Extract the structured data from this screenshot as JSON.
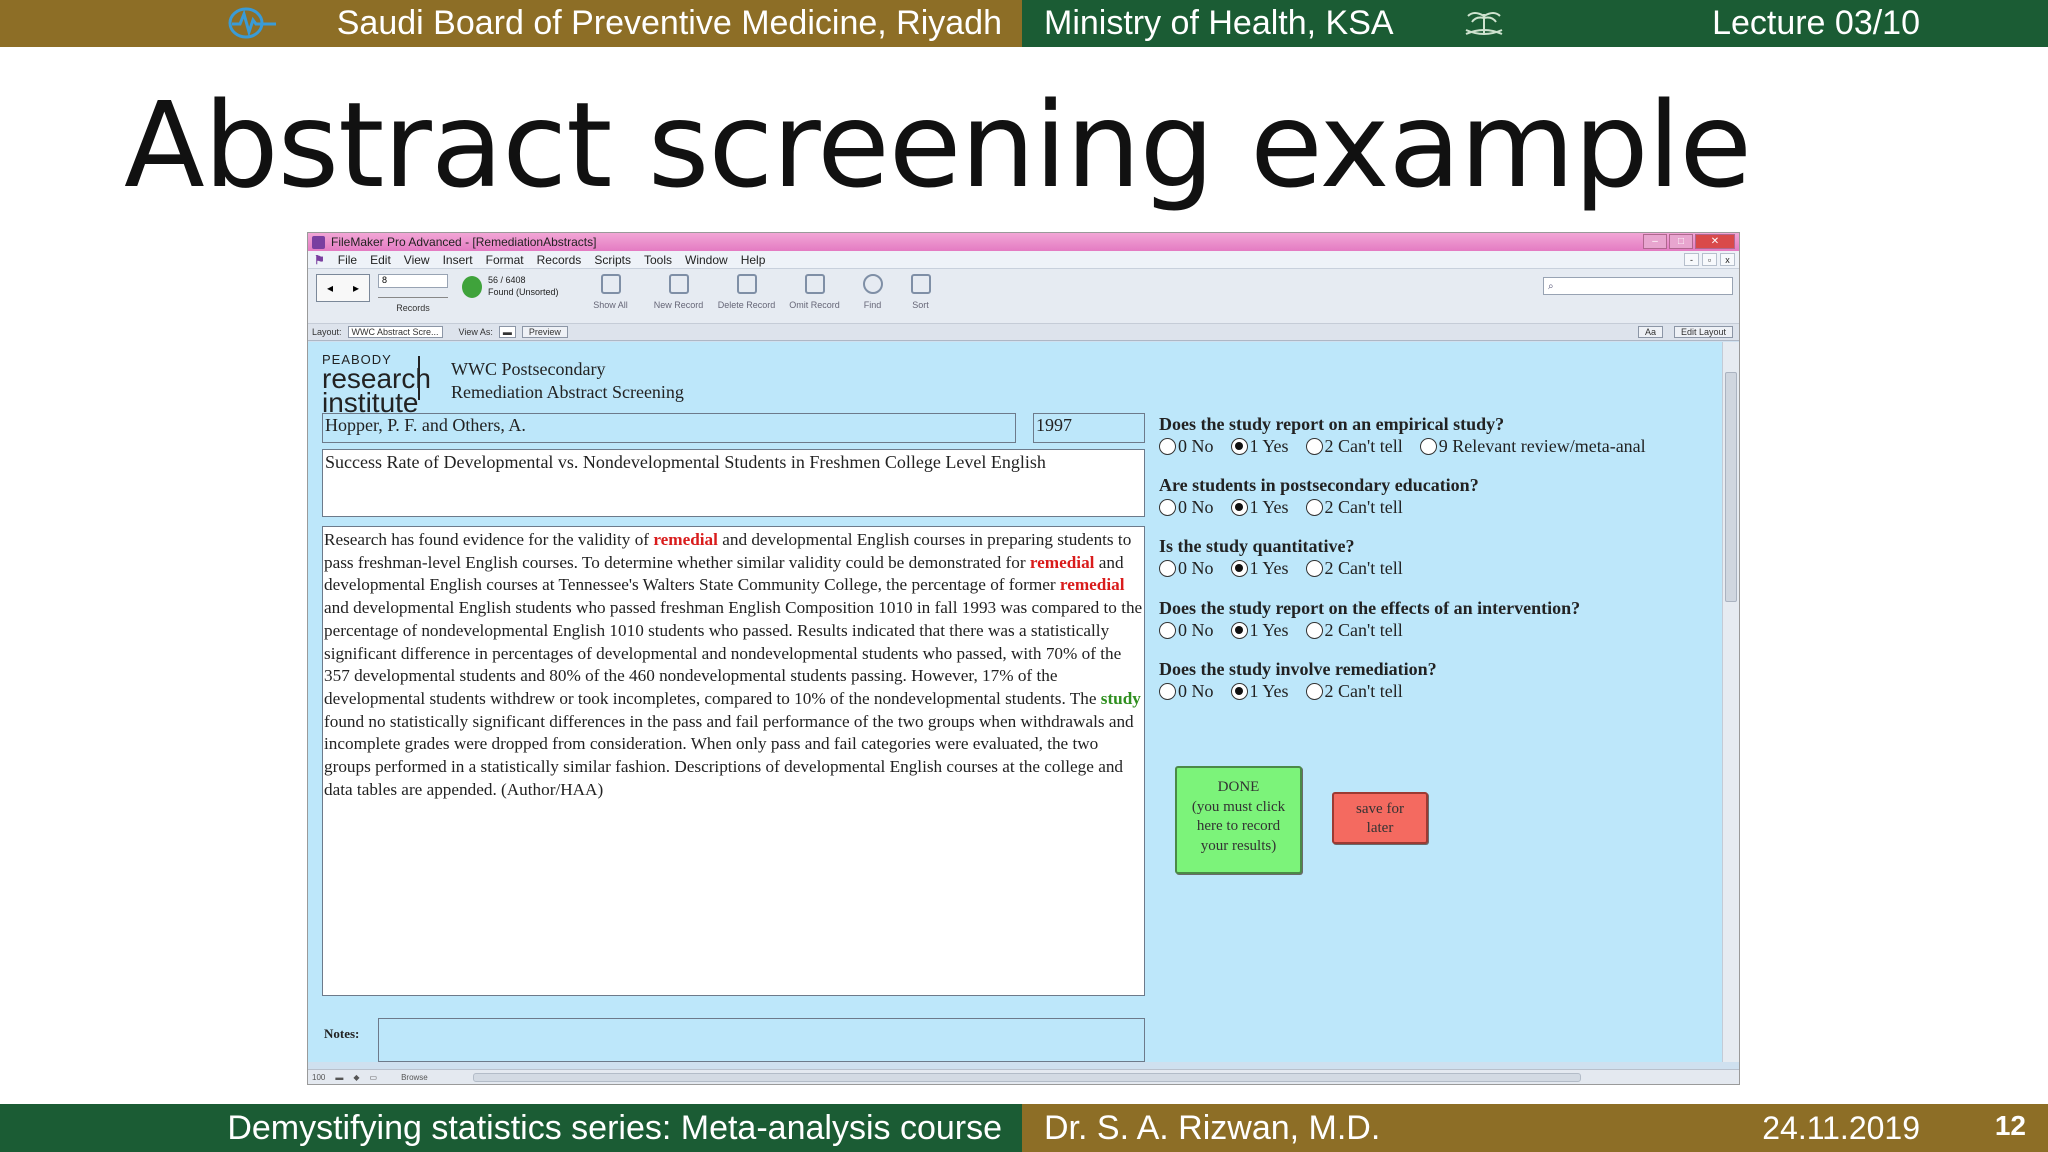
{
  "slide": {
    "header_left": "Saudi Board of Preventive Medicine, Riyadh",
    "header_right": "Ministry of Health, KSA",
    "lecture": "Lecture 03/10",
    "title": "Abstract screening example",
    "footer_left": "Demystifying statistics series: Meta-analysis course",
    "footer_right": "Dr. S. A. Rizwan, M.D.",
    "date": "24.11.2019",
    "slide_number": "12"
  },
  "app": {
    "window_title": "FileMaker Pro Advanced - [RemediationAbstracts]",
    "menu": [
      "File",
      "Edit",
      "View",
      "Insert",
      "Format",
      "Records",
      "Scripts",
      "Tools",
      "Window",
      "Help"
    ],
    "record_input": "8",
    "records_label": "Records",
    "found_count": "56 / 6408",
    "found_status": "Found (Unsorted)",
    "tools": {
      "show_all": "Show All",
      "new_record": "New Record",
      "delete_record": "Delete Record",
      "omit_record": "Omit Record",
      "find": "Find",
      "sort": "Sort"
    },
    "layout_label": "Layout:",
    "layout_value": "WWC Abstract Scre...",
    "view_as_label": "View As:",
    "preview": "Preview",
    "aa": "Aa",
    "edit_layout": "Edit Layout",
    "status_zoom": "100",
    "status_mode": "Browse"
  },
  "form": {
    "logo_line1": "PEABODY",
    "logo_line2": "research",
    "logo_line3": "institute",
    "header_line1": "WWC Postsecondary",
    "header_line2": "Remediation Abstract Screening",
    "author": "Hopper, P. F. and Others, A.",
    "year": "1997",
    "paper_title": "Success Rate of Developmental vs. Nondevelopmental Students in Freshmen College Level English",
    "abstract": {
      "s1": "Research has found evidence for the validity of ",
      "h1": "remedial",
      "s2": " and developmental English courses in preparing students to pass freshman-level English courses. To determine whether similar validity could be demonstrated for ",
      "h2": "remedial",
      "s3": " and developmental English courses at Tennessee's Walters State Community College, the percentage of former ",
      "h3": "remedial",
      "s4": " and developmental English students who passed freshman English Composition 1010 in fall 1993 was compared to the percentage of nondevelopmental English 1010 students who passed. Results indicated that there was a statistically significant difference in percentages of developmental and nondevelopmental students who passed, with 70% of the 357 developmental students and 80% of the 460 nondevelopmental students passing. However, 17% of the developmental students withdrew or took incompletes, compared to 10% of the nondevelopmental students. The ",
      "h4": "study",
      "s5": " found no statistically significant differences in the pass and fail performance of the two groups when withdrawals and incomplete grades were dropped from consideration. When only pass and fail categories were evaluated, the two groups performed in a statistically similar fashion. Descriptions of developmental English courses at the college and data tables are appended. (Author/HAA)"
    },
    "notes_label": "Notes:",
    "questions": [
      {
        "text": "Does the study report on an empirical study?",
        "options": [
          "0 No",
          "1 Yes",
          "2 Can't tell",
          "9 Relevant review/meta-anal"
        ],
        "selected": 1
      },
      {
        "text": "Are students in postsecondary education?",
        "options": [
          "0 No",
          "1 Yes",
          "2 Can't tell"
        ],
        "selected": 1
      },
      {
        "text": "Is the study quantitative?",
        "options": [
          "0 No",
          "1 Yes",
          "2 Can't tell"
        ],
        "selected": 1
      },
      {
        "text": "Does the study report on the effects of an intervention?",
        "options": [
          "0 No",
          "1 Yes",
          "2 Can't tell"
        ],
        "selected": 1
      },
      {
        "text": "Does the study involve remediation?",
        "options": [
          "0 No",
          "1 Yes",
          "2 Can't tell"
        ],
        "selected": 1
      }
    ],
    "done_line1": "DONE",
    "done_line2": "(you must click",
    "done_line3": "here to record",
    "done_line4": "your results)",
    "later_line1": "save for",
    "later_line2": "later"
  },
  "colors": {
    "gold": "#8d6e26",
    "green": "#1b5c34",
    "form_bg": "#bde7fa",
    "done_btn": "#7cf37a",
    "later_btn": "#f46a60",
    "highlight_red": "#d91c1c",
    "highlight_green": "#2f8f1f"
  }
}
